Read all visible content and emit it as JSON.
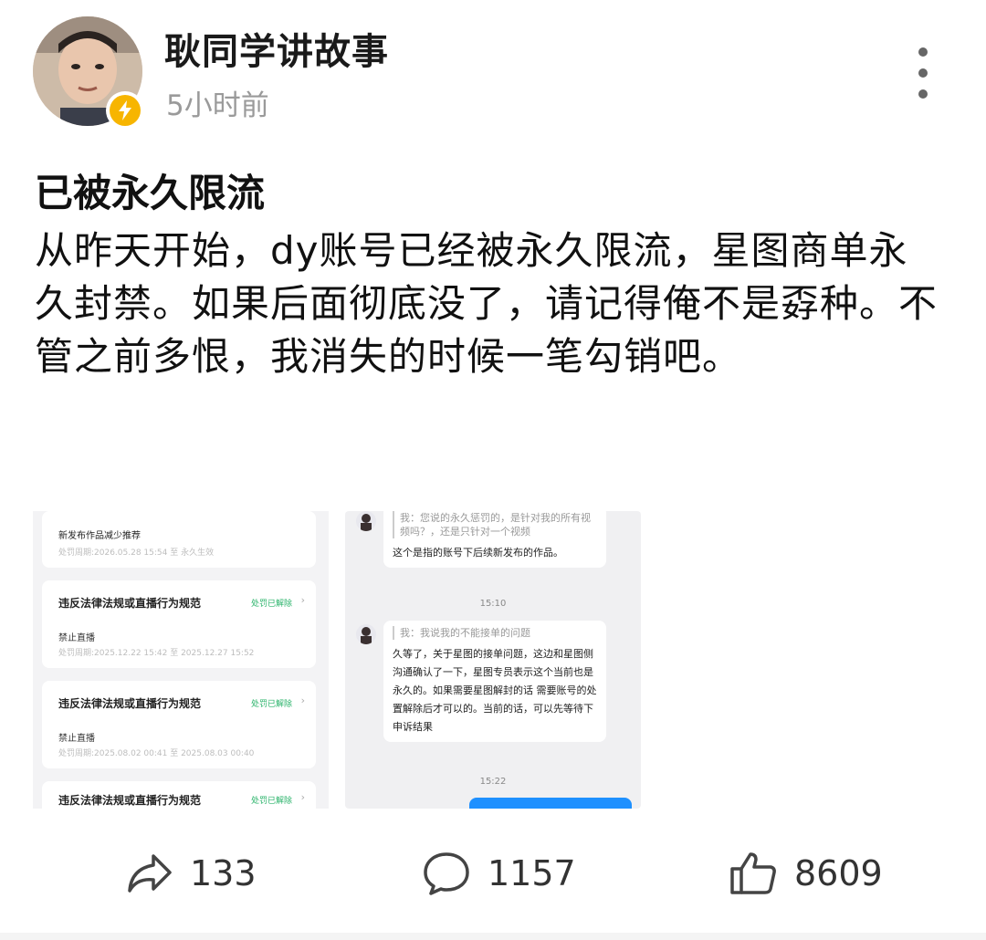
{
  "header": {
    "author": "耿同学讲故事",
    "time": "5小时前"
  },
  "post": {
    "title": "已被永久限流",
    "text": "从昨天开始，dy账号已经被永久限流，星图商单永久封禁。如果后面彻底没了，请记得俺不是孬种。不管之前多恨，我消失的时候一笔勾销吧。"
  },
  "left_image": {
    "cards": [
      {
        "title": "新发布作品减少推荐",
        "status": "",
        "sub": "",
        "period": "处罚周期:2026.05.28 15:54 至 永久生效"
      },
      {
        "title": "违反法律法规或直播行为规范",
        "status": "处罚已解除",
        "sub": "禁止直播",
        "period": "处罚周期:2025.12.22 15:42 至 2025.12.27 15:52"
      },
      {
        "title": "违反法律法规或直播行为规范",
        "status": "处罚已解除",
        "sub": "禁止直播",
        "period": "处罚周期:2025.08.02 00:41 至 2025.08.03 00:40"
      },
      {
        "title": "违反法律法规或直播行为规范",
        "status": "处罚已解除",
        "sub": "",
        "period": ""
      }
    ]
  },
  "right_image": {
    "msg1_quote": "我：您说的永久惩罚的，是针对我的所有视频吗？，还是只针对一个视频",
    "msg1_reply": "这个是指的账号下后续新发布的作品。",
    "time1": "15:10",
    "msg2_quote": "我：我说我的不能接单的问题",
    "msg2_reply": "久等了，关于星图的接单问题，这边和星图侧沟通确认了一下，星图专员表示这个当前也是永久的。如果需要星图解封的话 需要账号的处置解除后才可以的。当前的话，可以先等待下申诉结果",
    "time2": "15:22"
  },
  "actions": {
    "share_count": "133",
    "comment_count": "1157",
    "like_count": "8609"
  }
}
